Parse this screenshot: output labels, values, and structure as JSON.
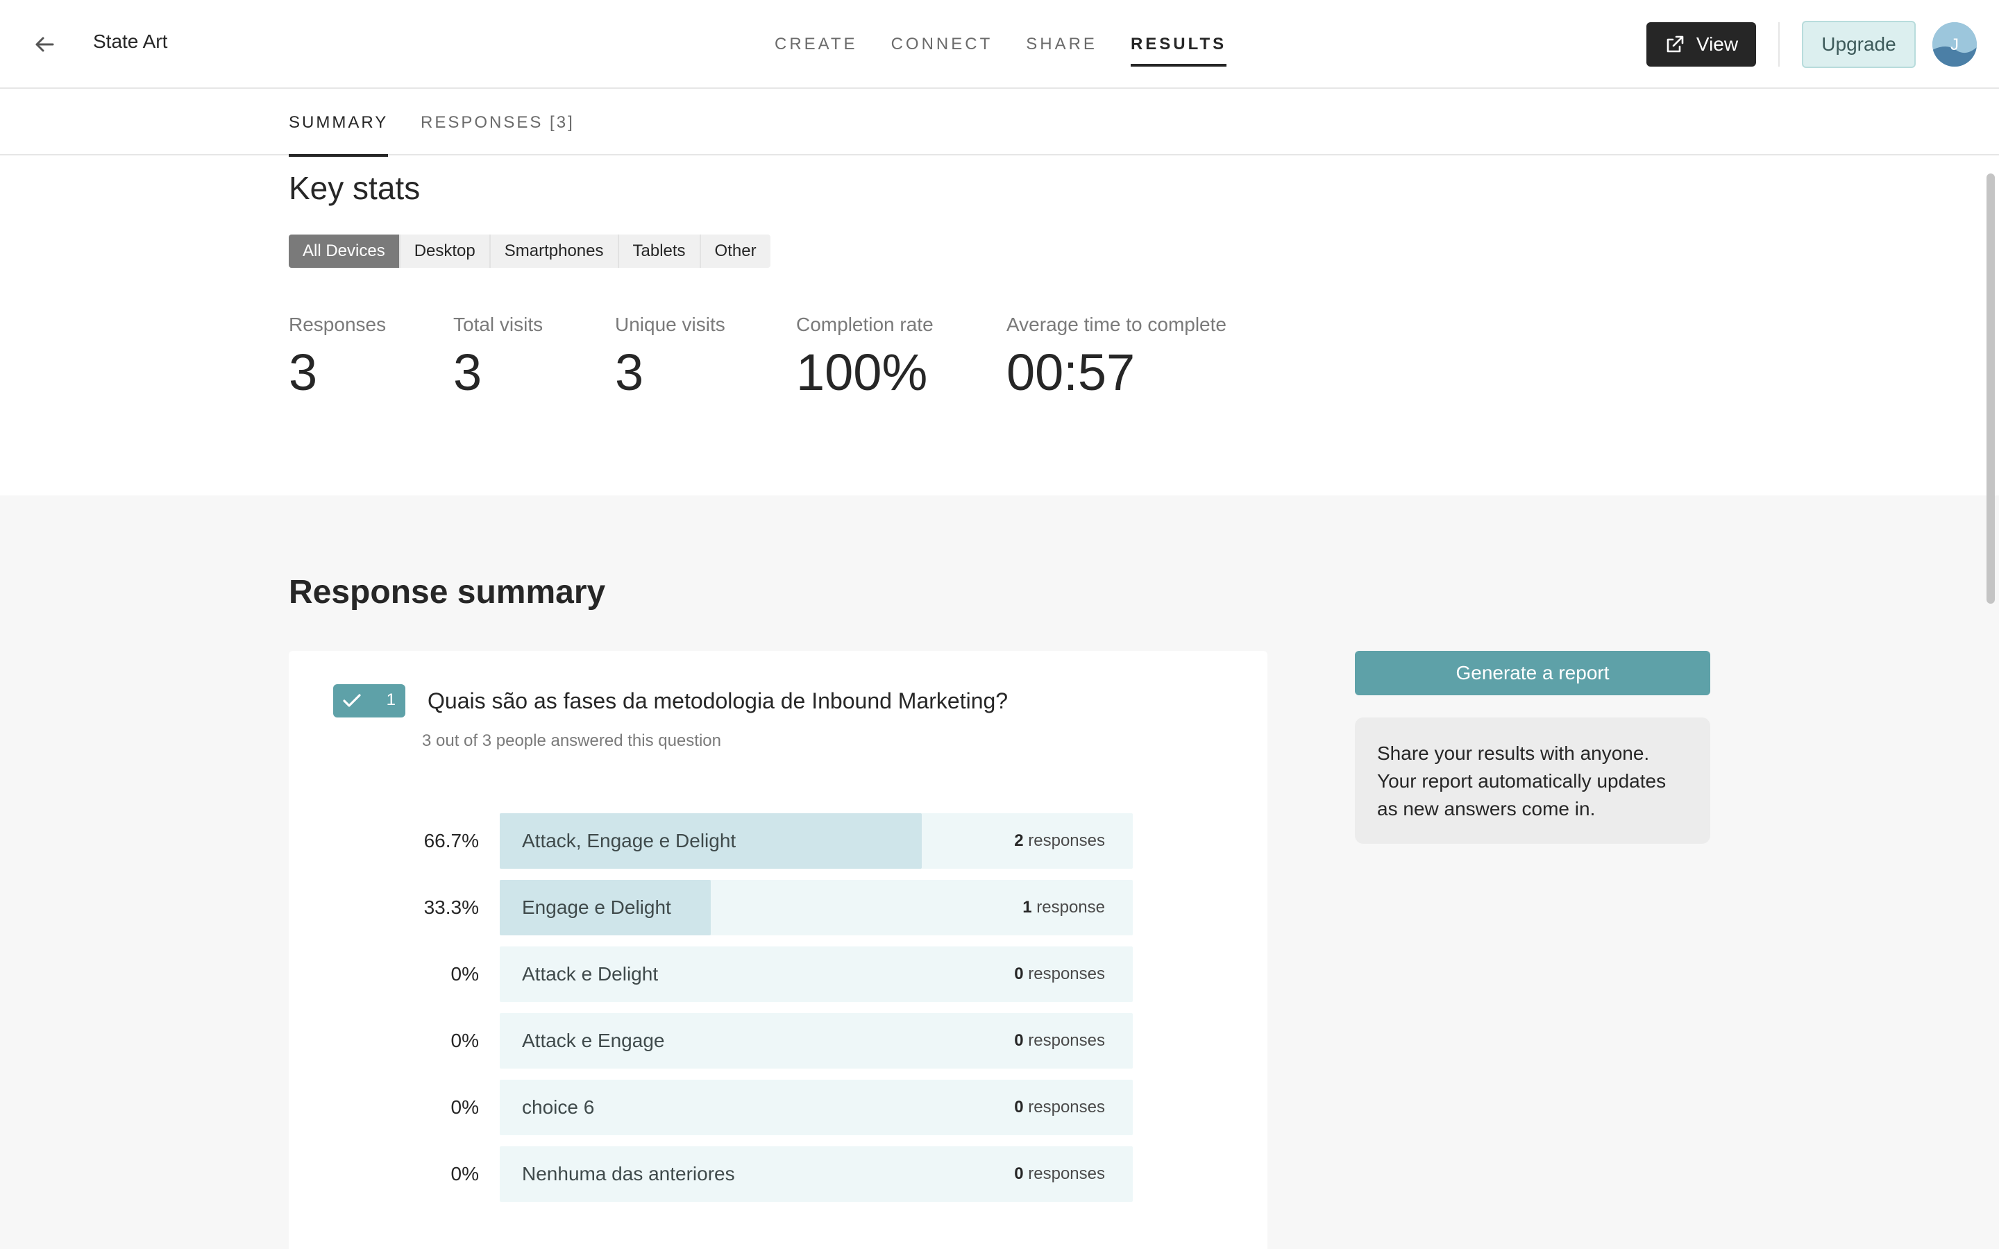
{
  "header": {
    "form_title": "State Art",
    "nav": [
      {
        "label": "CREATE"
      },
      {
        "label": "CONNECT"
      },
      {
        "label": "SHARE"
      },
      {
        "label": "RESULTS"
      }
    ],
    "view_label": "View",
    "upgrade_label": "Upgrade",
    "avatar_initial": "J"
  },
  "subtabs": {
    "summary": "SUMMARY",
    "responses": "RESPONSES [3]"
  },
  "key_stats": {
    "title": "Key stats",
    "devices": [
      "All Devices",
      "Desktop",
      "Smartphones",
      "Tablets",
      "Other"
    ],
    "selected_device": "All Devices",
    "stats": [
      {
        "label": "Responses",
        "value": "3"
      },
      {
        "label": "Total visits",
        "value": "3"
      },
      {
        "label": "Unique visits",
        "value": "3"
      },
      {
        "label": "Completion rate",
        "value": "100%"
      },
      {
        "label": "Average time to complete",
        "value": "00:57"
      }
    ]
  },
  "response_summary": {
    "title": "Response summary",
    "question": {
      "number": "1",
      "text": "Quais são as fases da metodologia de Inbound Marketing?",
      "answered": "3 out of 3 people answered this question",
      "options": [
        {
          "pct": "66.7%",
          "fraction": 0.667,
          "label": "Attack, Engage e Delight",
          "count": "2",
          "unit": "responses"
        },
        {
          "pct": "33.3%",
          "fraction": 0.333,
          "label": "Engage e Delight",
          "count": "1",
          "unit": "response"
        },
        {
          "pct": "0%",
          "fraction": 0,
          "label": "Attack e Delight",
          "count": "0",
          "unit": "responses"
        },
        {
          "pct": "0%",
          "fraction": 0,
          "label": "Attack e Engage",
          "count": "0",
          "unit": "responses"
        },
        {
          "pct": "0%",
          "fraction": 0,
          "label": "choice 6",
          "count": "0",
          "unit": "responses"
        },
        {
          "pct": "0%",
          "fraction": 0,
          "label": "Nenhuma das anteriores",
          "count": "0",
          "unit": "responses"
        }
      ]
    },
    "generate_report_label": "Generate a report",
    "share_text": "Share your results with anyone. Your report automatically updates as new answers come in."
  },
  "colors": {
    "accent": "#5ea1a8",
    "bar_fill": "#cfe5ea",
    "bar_track": "#eef7f8"
  }
}
